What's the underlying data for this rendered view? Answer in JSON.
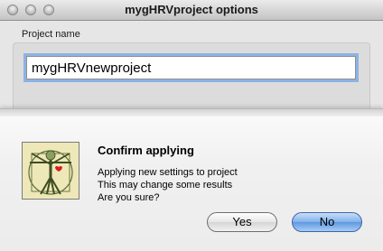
{
  "window": {
    "title": "mygHRVproject options"
  },
  "project": {
    "group_label": "Project name",
    "name_value": "mygHRVnewproject"
  },
  "dialog": {
    "title": "Confirm applying",
    "message_lines": [
      "Applying new settings to project",
      "This may change some results",
      "Are you sure?"
    ],
    "icon": "vitruvian-man-icon",
    "buttons": {
      "yes": "Yes",
      "no": "No"
    }
  }
}
